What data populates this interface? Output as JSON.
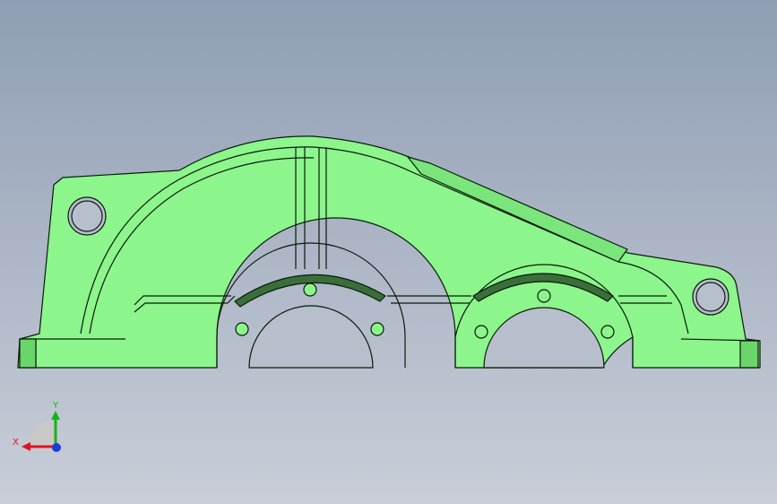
{
  "viewport": {
    "background_top": "#8f9eb4",
    "background_bottom": "#c9ced8"
  },
  "model": {
    "color_face": "#8cf58c",
    "color_shade": "#5fc95f",
    "color_edge": "#0a1a0a"
  },
  "triad": {
    "x_label": "X",
    "y_label": "Y",
    "x_color": "#e0141e",
    "y_color": "#14b414",
    "z_color": "#1e3cdc"
  }
}
